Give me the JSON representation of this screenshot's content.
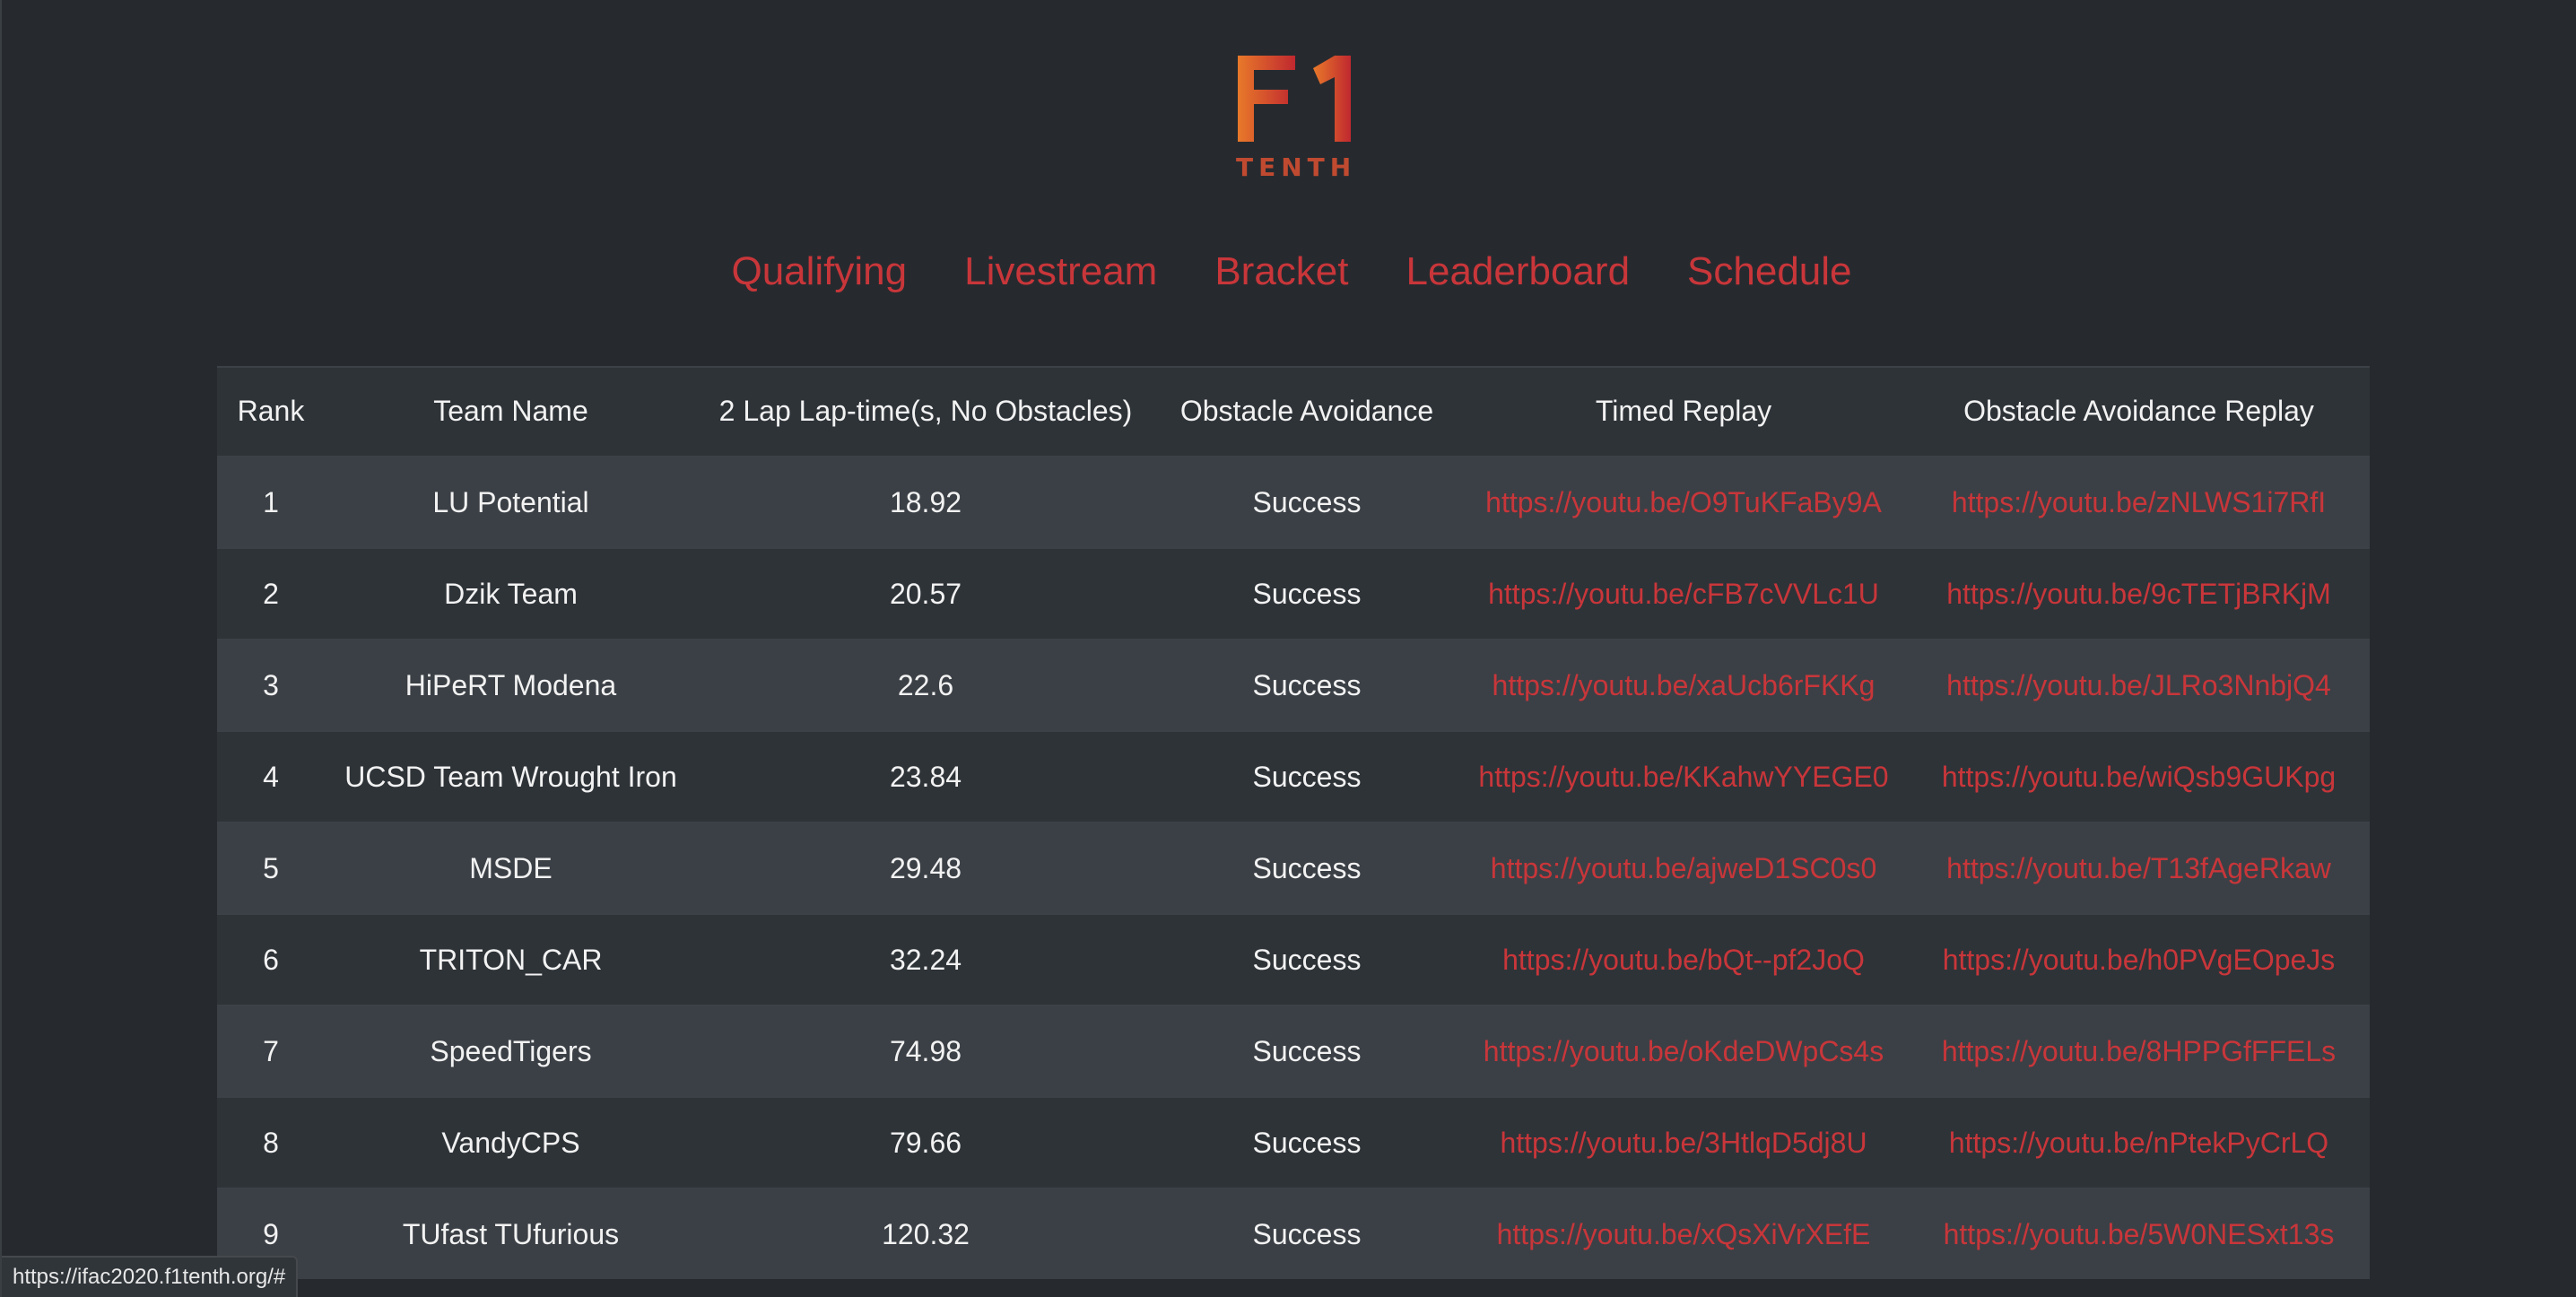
{
  "logo": {
    "mark": "F1",
    "subtitle": "TENTH",
    "colors": {
      "gradient_start": "#e8792a",
      "gradient_end": "#c0282f"
    }
  },
  "nav": {
    "items": [
      {
        "label": "Qualifying"
      },
      {
        "label": "Livestream"
      },
      {
        "label": "Bracket"
      },
      {
        "label": "Leaderboard"
      },
      {
        "label": "Schedule"
      }
    ]
  },
  "table": {
    "headers": {
      "rank": "Rank",
      "team": "Team Name",
      "time": "2 Lap Lap-time(s, No Obstacles)",
      "obstacle": "Obstacle Avoidance",
      "timed_replay": "Timed Replay",
      "obstacle_replay": "Obstacle Avoidance Replay"
    },
    "rows": [
      {
        "rank": "1",
        "team": "LU Potential",
        "time": "18.92",
        "obstacle": "Success",
        "timed_replay": "https://youtu.be/O9TuKFaBy9A",
        "obstacle_replay": "https://youtu.be/zNLWS1i7RfI"
      },
      {
        "rank": "2",
        "team": "Dzik Team",
        "time": "20.57",
        "obstacle": "Success",
        "timed_replay": "https://youtu.be/cFB7cVVLc1U",
        "obstacle_replay": "https://youtu.be/9cTETjBRKjM"
      },
      {
        "rank": "3",
        "team": "HiPeRT Modena",
        "time": "22.6",
        "obstacle": "Success",
        "timed_replay": "https://youtu.be/xaUcb6rFKKg",
        "obstacle_replay": "https://youtu.be/JLRo3NnbjQ4"
      },
      {
        "rank": "4",
        "team": "UCSD Team Wrought Iron",
        "time": "23.84",
        "obstacle": "Success",
        "timed_replay": "https://youtu.be/KKahwYYEGE0",
        "obstacle_replay": "https://youtu.be/wiQsb9GUKpg"
      },
      {
        "rank": "5",
        "team": "MSDE",
        "time": "29.48",
        "obstacle": "Success",
        "timed_replay": "https://youtu.be/ajweD1SC0s0",
        "obstacle_replay": "https://youtu.be/T13fAgeRkaw"
      },
      {
        "rank": "6",
        "team": "TRITON_CAR",
        "time": "32.24",
        "obstacle": "Success",
        "timed_replay": "https://youtu.be/bQt--pf2JoQ",
        "obstacle_replay": "https://youtu.be/h0PVgEOpeJs"
      },
      {
        "rank": "7",
        "team": "SpeedTigers",
        "time": "74.98",
        "obstacle": "Success",
        "timed_replay": "https://youtu.be/oKdeDWpCs4s",
        "obstacle_replay": "https://youtu.be/8HPPGfFFELs"
      },
      {
        "rank": "8",
        "team": "VandyCPS",
        "time": "79.66",
        "obstacle": "Success",
        "timed_replay": "https://youtu.be/3HtlqD5dj8U",
        "obstacle_replay": "https://youtu.be/nPtekPyCrLQ"
      },
      {
        "rank": "9",
        "team": "TUfast TUfurious",
        "time": "120.32",
        "obstacle": "Success",
        "timed_replay": "https://youtu.be/xQsXiVrXEfE",
        "obstacle_replay": "https://youtu.be/5W0NESxt13s"
      }
    ]
  },
  "status_bar": {
    "url": "https://ifac2020.f1tenth.org/#"
  },
  "colors": {
    "background": "#262a2f",
    "link": "#c8363a",
    "row_alt": "#3b4046",
    "row": "#2e3338",
    "text": "#f2f2f2"
  }
}
